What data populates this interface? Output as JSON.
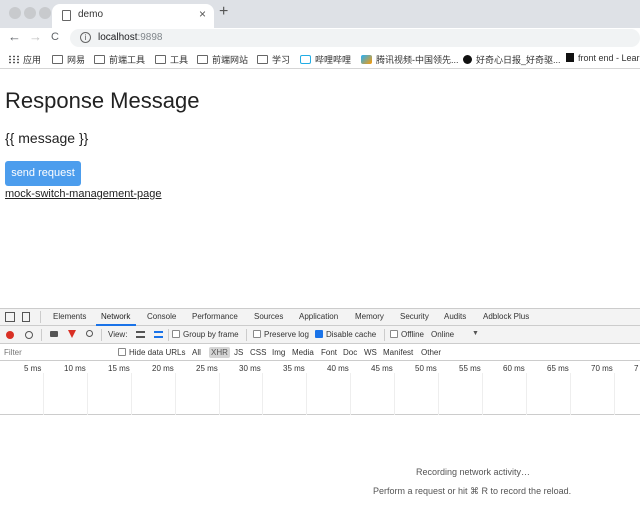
{
  "browser": {
    "tab_title": "demo",
    "tab_close": "×",
    "new_tab": "+",
    "nav": {
      "back": "←",
      "forward": "→",
      "reload": "C"
    },
    "url_host": "localhost",
    "url_port": ":9898",
    "bookmarks": [
      {
        "label": "应用",
        "icon": "apps-grid-icon"
      },
      {
        "label": "网易",
        "icon": "folder-icon"
      },
      {
        "label": "前端工具",
        "icon": "folder-icon"
      },
      {
        "label": "工具",
        "icon": "folder-icon"
      },
      {
        "label": "前端网站",
        "icon": "folder-icon"
      },
      {
        "label": "学习",
        "icon": "folder-icon"
      },
      {
        "label": "哔哩哔哩",
        "icon": "bilibili-icon"
      },
      {
        "label": "腾讯视频-中国领先...",
        "icon": "tencent-video-icon"
      },
      {
        "label": "好奇心日报_好奇驱...",
        "icon": "qdaily-icon"
      },
      {
        "label": "front end - Lear",
        "icon": "mdn-icon"
      }
    ]
  },
  "page": {
    "title": "Response Message",
    "message": "{{ message }}",
    "send_button": "send request",
    "link": "mock-switch-management-page"
  },
  "devtools": {
    "tabs": [
      "Elements",
      "Network",
      "Console",
      "Performance",
      "Sources",
      "Application",
      "Memory",
      "Security",
      "Audits",
      "Adblock Plus"
    ],
    "active_tab": "Network",
    "toolbar": {
      "view_label": "View:",
      "group_by_frame": "Group by frame",
      "preserve_log": "Preserve log",
      "disable_cache": "Disable cache",
      "disable_cache_checked": true,
      "offline": "Offline",
      "throttle": "Online"
    },
    "filter": {
      "placeholder": "Filter",
      "hide_data_urls": "Hide data URLs",
      "types": [
        "All",
        "XHR",
        "JS",
        "CSS",
        "Img",
        "Media",
        "Font",
        "Doc",
        "WS",
        "Manifest",
        "Other"
      ],
      "active_type": "XHR"
    },
    "timeline_ticks": [
      "5 ms",
      "10 ms",
      "15 ms",
      "20 ms",
      "25 ms",
      "30 ms",
      "35 ms",
      "40 ms",
      "45 ms",
      "50 ms",
      "55 ms",
      "60 ms",
      "65 ms",
      "70 ms",
      "7"
    ],
    "empty_line1": "Recording network activity…",
    "empty_line2": "Perform a request or hit ⌘ R to record the reload."
  },
  "colors": {
    "button_bg": "#4c9ded",
    "record_red": "#d93025",
    "active_tab_blue": "#1a73e8"
  }
}
